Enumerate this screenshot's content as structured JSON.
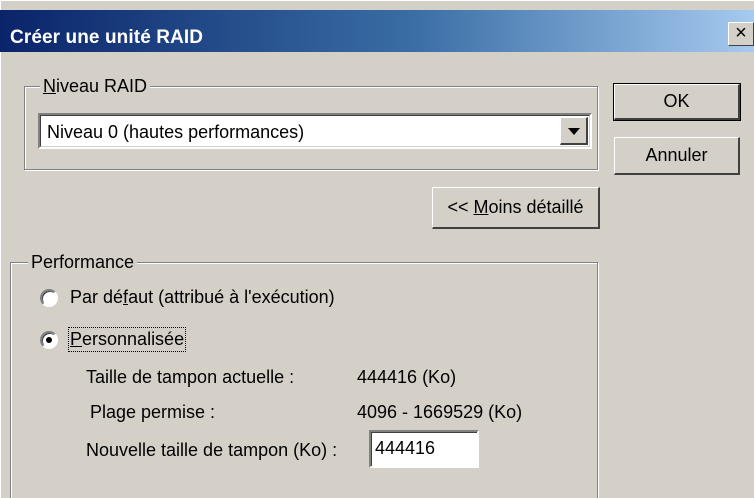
{
  "window": {
    "title": "Créer une unité RAID",
    "close_symbol": "×"
  },
  "raid_group": {
    "label_first": "N",
    "label_rest": "iveau RAID",
    "selected_value": "Niveau 0 (hautes performances)"
  },
  "buttons": {
    "ok": "OK",
    "cancel": "Annuler",
    "less_detail_prefix": "<< ",
    "less_detail_access": "M",
    "less_detail_rest": "oins détaillé"
  },
  "performance_group": {
    "label": "Performance",
    "option_default_a": "Par dé",
    "option_default_access": "f",
    "option_default_b": "aut (attribué à l'exécution)",
    "option_custom_access": "P",
    "option_custom_rest": "ersonnalisée",
    "selected": "custom"
  },
  "details": {
    "current_label": "Taille de tampon actuelle :",
    "current_value": "444416 (Ko)",
    "range_label": "Plage permise :",
    "range_value": "4096 - 1669529 (Ko)",
    "new_label": "Nouvelle taille de tampon (Ko) :",
    "new_value": "444416"
  }
}
